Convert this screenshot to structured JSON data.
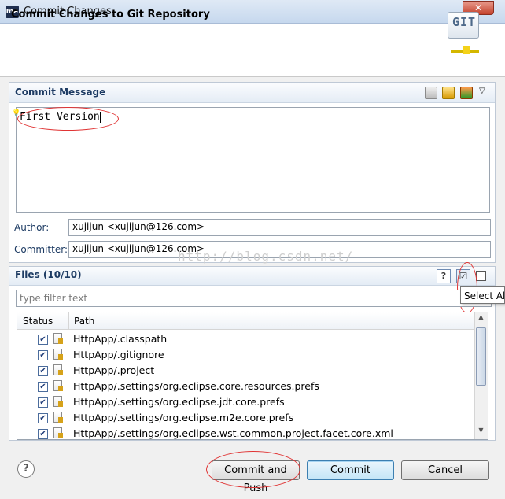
{
  "window": {
    "app_icon_text": "me",
    "title": "Commit Changes",
    "close_label": "✕"
  },
  "header": {
    "title": "Commit Changes to Git Repository",
    "logo_text": "GIT"
  },
  "commit_message": {
    "section_title": "Commit Message",
    "text": "First Version"
  },
  "author": {
    "label": "Author:",
    "value": "xujijun <xujijun@126.com>"
  },
  "committer": {
    "label": "Committer:",
    "value": "xujijun <xujijun@126.com>"
  },
  "watermark": "http://blog.csdn.net/",
  "files": {
    "section_title": "Files (10/10)",
    "filter_placeholder": "type filter text",
    "tooltip": "Select All",
    "columns": [
      "Status",
      "Path"
    ],
    "rows": [
      {
        "checked": true,
        "path": "HttpApp/.classpath"
      },
      {
        "checked": true,
        "path": "HttpApp/.gitignore"
      },
      {
        "checked": true,
        "path": "HttpApp/.project"
      },
      {
        "checked": true,
        "path": "HttpApp/.settings/org.eclipse.core.resources.prefs"
      },
      {
        "checked": true,
        "path": "HttpApp/.settings/org.eclipse.jdt.core.prefs"
      },
      {
        "checked": true,
        "path": "HttpApp/.settings/org.eclipse.m2e.core.prefs"
      },
      {
        "checked": true,
        "path": "HttpApp/.settings/org.eclipse.wst.common.project.facet.core.xml"
      }
    ]
  },
  "buttons": {
    "help": "?",
    "commit_and_push": "Commit and Push",
    "commit": "Commit",
    "cancel": "Cancel"
  },
  "annotation_color": "#e03434"
}
